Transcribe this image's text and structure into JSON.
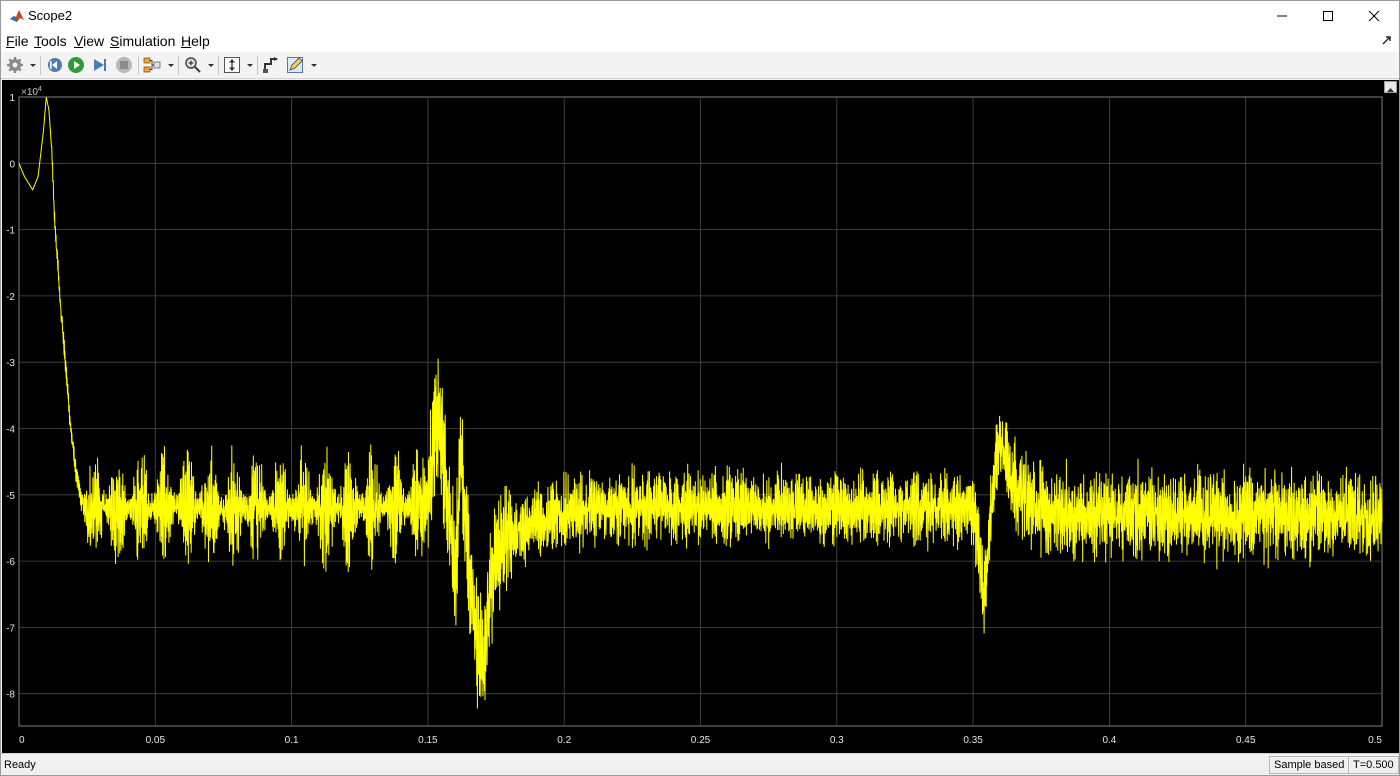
{
  "window": {
    "title": "Scope2"
  },
  "menu": [
    {
      "label": "File",
      "mnemonic": "F",
      "rest": "ile"
    },
    {
      "label": "Tools",
      "mnemonic": "T",
      "rest": "ools"
    },
    {
      "label": "View",
      "mnemonic": "V",
      "rest": "iew"
    },
    {
      "label": "Simulation",
      "mnemonic": "S",
      "rest": "imulation"
    },
    {
      "label": "Help",
      "mnemonic": "H",
      "rest": "elp"
    }
  ],
  "toolbar": {
    "icons": [
      "settings-icon",
      "step-back-icon",
      "run-icon",
      "step-forward-icon",
      "stop-icon",
      "highlight-simulink-block-icon",
      "zoom-icon",
      "scale-axes-icon",
      "restore-view-icon",
      "edit-style-icon"
    ]
  },
  "status": {
    "ready": "Ready",
    "mode": "Sample based",
    "time": "T=0.500"
  },
  "colors": {
    "plot_background": "#000000",
    "grid": "#4a4a4a",
    "axes": "#7f7f7f",
    "trace": "#ffff00",
    "tick_text": "#e6e6e6"
  },
  "chart_data": {
    "type": "line",
    "exponent_label": "×10",
    "exponent_power": "4",
    "xlim": [
      0,
      0.5
    ],
    "ylim": [
      -8.5,
      1
    ],
    "x_ticks": [
      "0",
      "0.05",
      "0.1",
      "0.15",
      "0.2",
      "0.25",
      "0.3",
      "0.35",
      "0.4",
      "0.45",
      "0.5"
    ],
    "x_tick_values": [
      0,
      0.05,
      0.1,
      0.15,
      0.2,
      0.25,
      0.3,
      0.35,
      0.4,
      0.45,
      0.5
    ],
    "y_ticks": [
      "1",
      "0",
      "-1",
      "-2",
      "-3",
      "-4",
      "-5",
      "-6",
      "-7",
      "-8"
    ],
    "y_tick_values": [
      1,
      0,
      -1,
      -2,
      -3,
      -4,
      -5,
      -6,
      -7,
      -8
    ],
    "grid": true,
    "series": [
      {
        "color": "#ffff00",
        "x": [
          0,
          0.002,
          0.005,
          0.007,
          0.009,
          0.01,
          0.011,
          0.012,
          0.013,
          0.015,
          0.017,
          0.019,
          0.021,
          0.023,
          0.025,
          0.03,
          0.04,
          0.05,
          0.06,
          0.07,
          0.08,
          0.09,
          0.1,
          0.11,
          0.12,
          0.13,
          0.14,
          0.15,
          0.152,
          0.154,
          0.156,
          0.158,
          0.16,
          0.162,
          0.164,
          0.166,
          0.168,
          0.17,
          0.172,
          0.175,
          0.18,
          0.19,
          0.2,
          0.21,
          0.22,
          0.23,
          0.24,
          0.25,
          0.26,
          0.27,
          0.28,
          0.29,
          0.3,
          0.31,
          0.32,
          0.33,
          0.34,
          0.35,
          0.352,
          0.354,
          0.356,
          0.358,
          0.36,
          0.362,
          0.365,
          0.37,
          0.38,
          0.39,
          0.4,
          0.42,
          0.44,
          0.46,
          0.48,
          0.5
        ],
        "y": [
          0,
          -0.2,
          -0.4,
          -0.2,
          0.5,
          1,
          0.8,
          0.2,
          -0.8,
          -2,
          -3,
          -4,
          -4.7,
          -5.1,
          -5.3,
          -5.2,
          -5.2,
          -5.2,
          -5.2,
          -5.2,
          -5.2,
          -5.2,
          -5.2,
          -5.2,
          -5.2,
          -5.2,
          -5.2,
          -5.1,
          -4.2,
          -3.8,
          -4.6,
          -5.4,
          -6.2,
          -4.5,
          -5.5,
          -6.5,
          -7.2,
          -7.5,
          -6.8,
          -6,
          -5.6,
          -5.4,
          -5.3,
          -5.2,
          -5.2,
          -5.2,
          -5.2,
          -5.2,
          -5.2,
          -5.2,
          -5.2,
          -5.2,
          -5.2,
          -5.2,
          -5.2,
          -5.2,
          -5.2,
          -5.2,
          -5.8,
          -6.6,
          -5.5,
          -4.6,
          -4.2,
          -4.4,
          -4.8,
          -5.1,
          -5.3,
          -5.3,
          -5.3,
          -5.3,
          -5.3,
          -5.3,
          -5.3,
          -5.3
        ]
      }
    ]
  }
}
